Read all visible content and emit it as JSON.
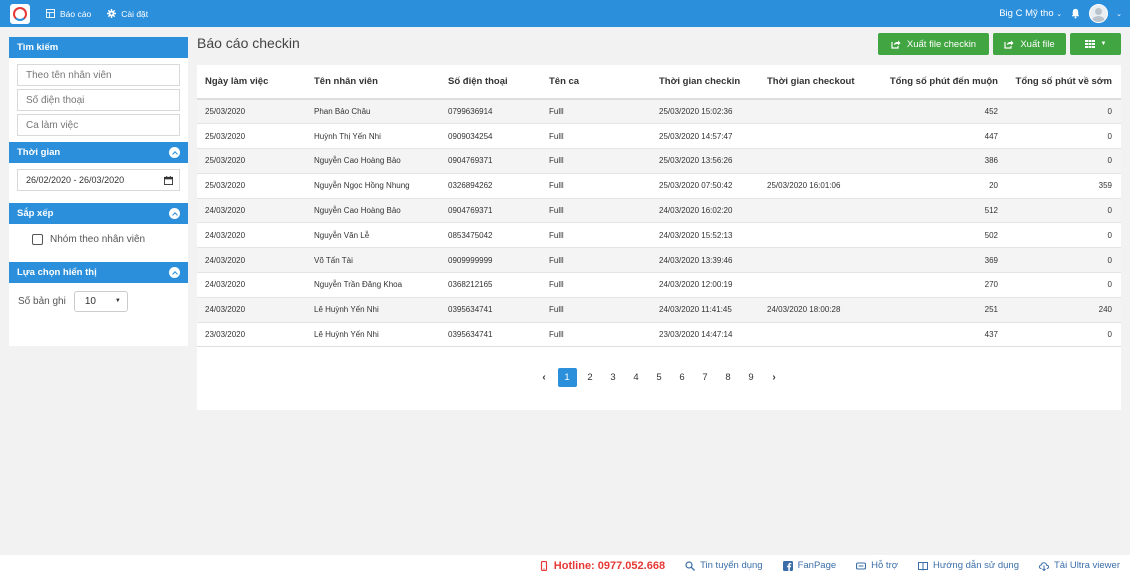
{
  "nav": {
    "report": "Báo cáo",
    "settings": "Cài đặt",
    "store": "Big C Mỹ tho"
  },
  "sidebar": {
    "search": {
      "title": "Tìm kiếm",
      "employee_placeholder": "Theo tên nhân viên",
      "phone_placeholder": "Số điện thoại",
      "shift_placeholder": "Ca làm việc"
    },
    "time": {
      "title": "Thời gian",
      "range": "26/02/2020 - 26/03/2020"
    },
    "sort": {
      "title": "Sắp xếp",
      "group_label": "Nhóm theo nhân viên"
    },
    "display": {
      "title": "Lựa chọn hiển thị",
      "records_label": "Số bản ghi",
      "records_value": "10"
    }
  },
  "main": {
    "title": "Báo cáo checkin",
    "export_checkin": "Xuất file checkin",
    "export_file": "Xuất file"
  },
  "table": {
    "headers": [
      "Ngày làm việc",
      "Tên nhân viên",
      "Số điện thoại",
      "Tên ca",
      "Thời gian checkin",
      "Thời gian checkout",
      "Tổng số phút đến muộn",
      "Tổng số phút về sớm"
    ],
    "rows": [
      [
        "25/03/2020",
        "Phan Bảo Châu",
        "0799636914",
        "Fulll",
        "25/03/2020 15:02:36",
        "",
        "452",
        "0"
      ],
      [
        "25/03/2020",
        "Huỳnh Thị Yến Nhi",
        "0909034254",
        "Fulll",
        "25/03/2020 14:57:47",
        "",
        "447",
        "0"
      ],
      [
        "25/03/2020",
        "Nguyễn Cao Hoàng Bảo",
        "0904769371",
        "Fulll",
        "25/03/2020 13:56:26",
        "",
        "386",
        "0"
      ],
      [
        "25/03/2020",
        "Nguyễn Ngọc Hồng Nhung",
        "0326894262",
        "Fulll",
        "25/03/2020 07:50:42",
        "25/03/2020 16:01:06",
        "20",
        "359"
      ],
      [
        "24/03/2020",
        "Nguyễn Cao Hoàng Bảo",
        "0904769371",
        "Fulll",
        "24/03/2020 16:02:20",
        "",
        "512",
        "0"
      ],
      [
        "24/03/2020",
        "Nguyễn Văn Lễ",
        "0853475042",
        "Fulll",
        "24/03/2020 15:52:13",
        "",
        "502",
        "0"
      ],
      [
        "24/03/2020",
        "Võ Tấn Tài",
        "0909999999",
        "Fulll",
        "24/03/2020 13:39:46",
        "",
        "369",
        "0"
      ],
      [
        "24/03/2020",
        "Nguyễn Trần Đăng Khoa",
        "0368212165",
        "Fulll",
        "24/03/2020 12:00:19",
        "",
        "270",
        "0"
      ],
      [
        "24/03/2020",
        "Lê Huỳnh Yến Nhi",
        "0395634741",
        "Fulll",
        "24/03/2020 11:41:45",
        "24/03/2020 18:00:28",
        "251",
        "240"
      ],
      [
        "23/03/2020",
        "Lê Huỳnh Yến Nhi",
        "0395634741",
        "Fulll",
        "23/03/2020 14:47:14",
        "",
        "437",
        "0"
      ]
    ]
  },
  "pagination": {
    "prev": "‹",
    "next": "›",
    "pages": [
      "1",
      "2",
      "3",
      "4",
      "5",
      "6",
      "7",
      "8",
      "9"
    ],
    "active": "1"
  },
  "footer": {
    "hotline": "Hotline: 0977.052.668",
    "jobs": "Tin tuyển dụng",
    "fanpage": "FanPage",
    "support": "Hỗ trợ",
    "guide": "Hướng dẫn sử dụng",
    "viewer": "Tải Ultra viewer"
  },
  "colors": {
    "primary": "#2b8fdc",
    "success": "#41a541",
    "hotline": "#e53935"
  },
  "icons": [
    "logo",
    "report-icon",
    "gear-icon",
    "bell-icon",
    "avatar",
    "calendar-icon",
    "export-icon",
    "grid-icon",
    "phone-icon",
    "search-icon",
    "facebook-icon",
    "support-icon",
    "book-icon",
    "cloud-download-icon"
  ]
}
